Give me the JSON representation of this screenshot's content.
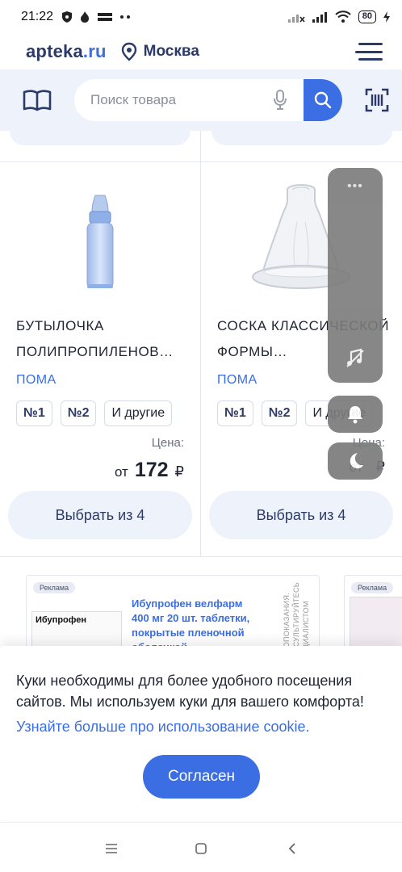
{
  "status_bar": {
    "time": "21:22",
    "battery": "80",
    "icons": [
      "shield-icon",
      "flame-icon",
      "app-badge-icon",
      "more-dots-icon",
      "signal-off-icon",
      "signal-icon",
      "wifi-icon",
      "battery-icon",
      "charging-icon"
    ]
  },
  "header": {
    "logo_main": "apteka",
    "logo_suffix": ".ru",
    "city": "Москва"
  },
  "search": {
    "placeholder": "Поиск товара"
  },
  "products": [
    {
      "title": "БУТЫЛОЧКА ПОЛИПРОПИЛЕНОВ…",
      "brand": "ПОМА",
      "chips": [
        "№1",
        "№2",
        "И другие"
      ],
      "price_label": "Цена:",
      "price_prefix": "от",
      "price": "172",
      "currency": "₽",
      "button": "Выбрать из 4"
    },
    {
      "title": "СОСКА КЛАССИЧЕСКОЙ ФОРМЫ…",
      "brand": "ПОМА",
      "chips": [
        "№1",
        "№2",
        "И другие"
      ],
      "price_label": "Цена:",
      "price_prefix": "от",
      "price": "",
      "currency": "₽",
      "button": "Выбрать из 4"
    }
  ],
  "ads": [
    {
      "badge": "Реклама",
      "pack_title": "Ибупрофен",
      "text": "Ибупрофен велфарм 400 мг 20 шт. таблетки, покрытые пленочной оболочкой",
      "side_text": "ЕСТЬ ПРОТИВОПОКАЗАНИЯ. ПРОКОНСУЛЬТИРУЙТЕСЬ СО СПЕЦИАЛИСТОМ"
    },
    {
      "badge": "Реклама"
    }
  ],
  "cookie": {
    "text": "Куки необходимы для более удобного посещения сайтов. Мы используем куки для вашего комфорта!",
    "link": "Узнайте больше про использование cookie.",
    "button": "Согласен"
  },
  "colors": {
    "primary": "#3b6ee3",
    "navy": "#2b3a67",
    "soft_bg": "#eef2fb"
  }
}
